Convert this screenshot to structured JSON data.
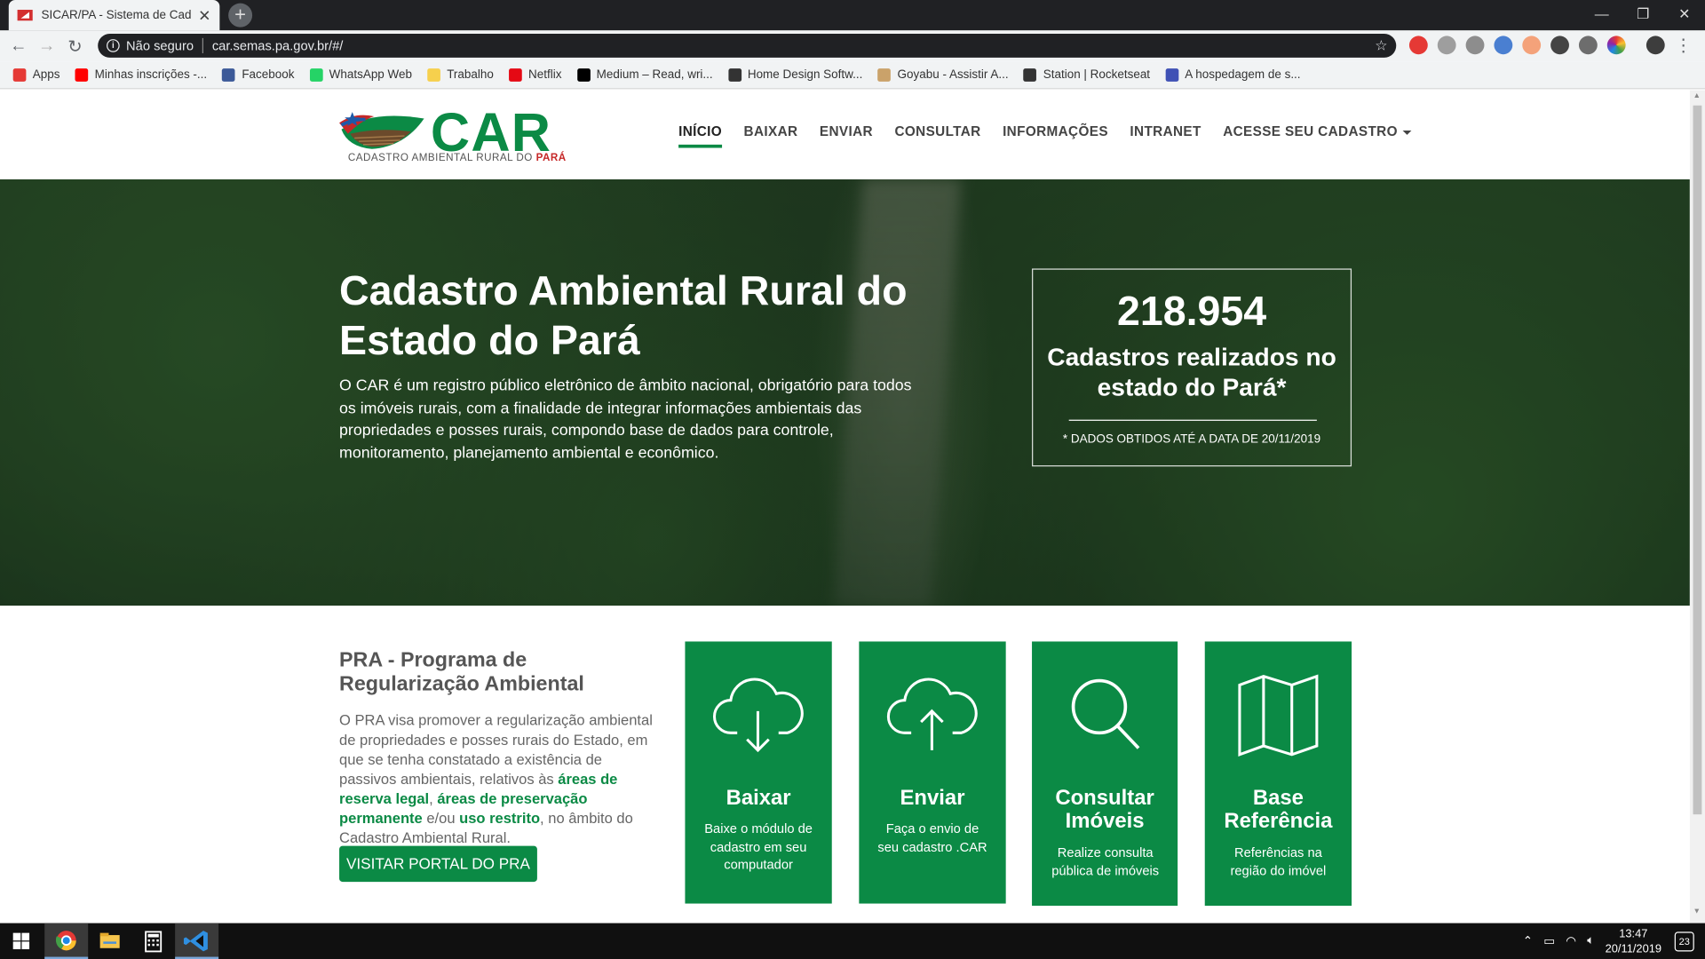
{
  "browser": {
    "tab_title": "SICAR/PA - Sistema de Cadastro",
    "security_label": "Não seguro",
    "url": "car.semas.pa.gov.br/#/",
    "bookmarks": [
      {
        "label": "Apps",
        "color": "#e53935"
      },
      {
        "label": "Minhas inscrições -...",
        "color": "#ff0000"
      },
      {
        "label": "Facebook",
        "color": "#3b5998"
      },
      {
        "label": "WhatsApp Web",
        "color": "#25d366"
      },
      {
        "label": "Trabalho",
        "color": "#f6d04d"
      },
      {
        "label": "Netflix",
        "color": "#e50914"
      },
      {
        "label": "Medium – Read, wri...",
        "color": "#000000"
      },
      {
        "label": "Home Design Softw...",
        "color": "#333333"
      },
      {
        "label": "Goyabu - Assistir A...",
        "color": "#caa26a"
      },
      {
        "label": "Station | Rocketseat",
        "color": "#333333"
      },
      {
        "label": "A hospedagem de s...",
        "color": "#3f51b5"
      }
    ]
  },
  "site": {
    "logo_text": "CAR",
    "logo_sub": "CADASTRO AMBIENTAL RURAL DO ",
    "logo_sub_state": "PARÁ",
    "nav": [
      {
        "label": "INÍCIO",
        "active": true
      },
      {
        "label": "BAIXAR"
      },
      {
        "label": "ENVIAR"
      },
      {
        "label": "CONSULTAR"
      },
      {
        "label": "INFORMAÇÕES"
      },
      {
        "label": "INTRANET"
      },
      {
        "label": "ACESSE SEU CADASTRO"
      }
    ]
  },
  "hero": {
    "title": "Cadastro Ambiental Rural do Estado do Pará",
    "text": "O CAR é um registro público eletrônico de âmbito nacional, obrigatório para todos os imóveis rurais, com a finalidade de integrar informações ambientais das propriedades e posses rurais, compondo base de dados para controle, monitoramento, planejamento ambiental e econômico.",
    "stat_number": "218.954",
    "stat_label": "Cadastros realizados no estado do Pará*",
    "stat_note": "* DADOS OBTIDOS ATÉ A DATA DE 20/11/2019"
  },
  "pra": {
    "title": "PRA - Programa de Regularização Ambiental",
    "text_1": "O PRA visa promover a regularização ambiental de propriedades e posses rurais do Estado, em que se tenha constatado a existência de passivos ambientais, relativos às ",
    "hl_1": "áreas de reserva legal",
    "text_2": ", ",
    "hl_2": "áreas de preservação permanente",
    "text_3": " e/ou ",
    "hl_3": "uso restrito",
    "text_4": ", no âmbito do Cadastro Ambiental Rural.",
    "button": "VISITAR PORTAL DO PRA"
  },
  "cards": [
    {
      "title": "Baixar",
      "desc": "Baixe o módulo de cadastro em seu computador",
      "icon": "cloud-download-icon"
    },
    {
      "title": "Enviar",
      "desc": "Faça o envio de seu cadastro .CAR",
      "icon": "cloud-upload-icon"
    },
    {
      "title": "Consultar Imóveis",
      "desc": "Realize consulta pública de imóveis",
      "icon": "search-icon"
    },
    {
      "title": "Base Referência",
      "desc": "Referências na região do imóvel",
      "icon": "map-icon"
    }
  ],
  "taskbar": {
    "time": "13:47",
    "date": "20/11/2019",
    "notifications": "23"
  },
  "colors": {
    "brand_green": "#0b8a45",
    "brand_red": "#c62828"
  }
}
